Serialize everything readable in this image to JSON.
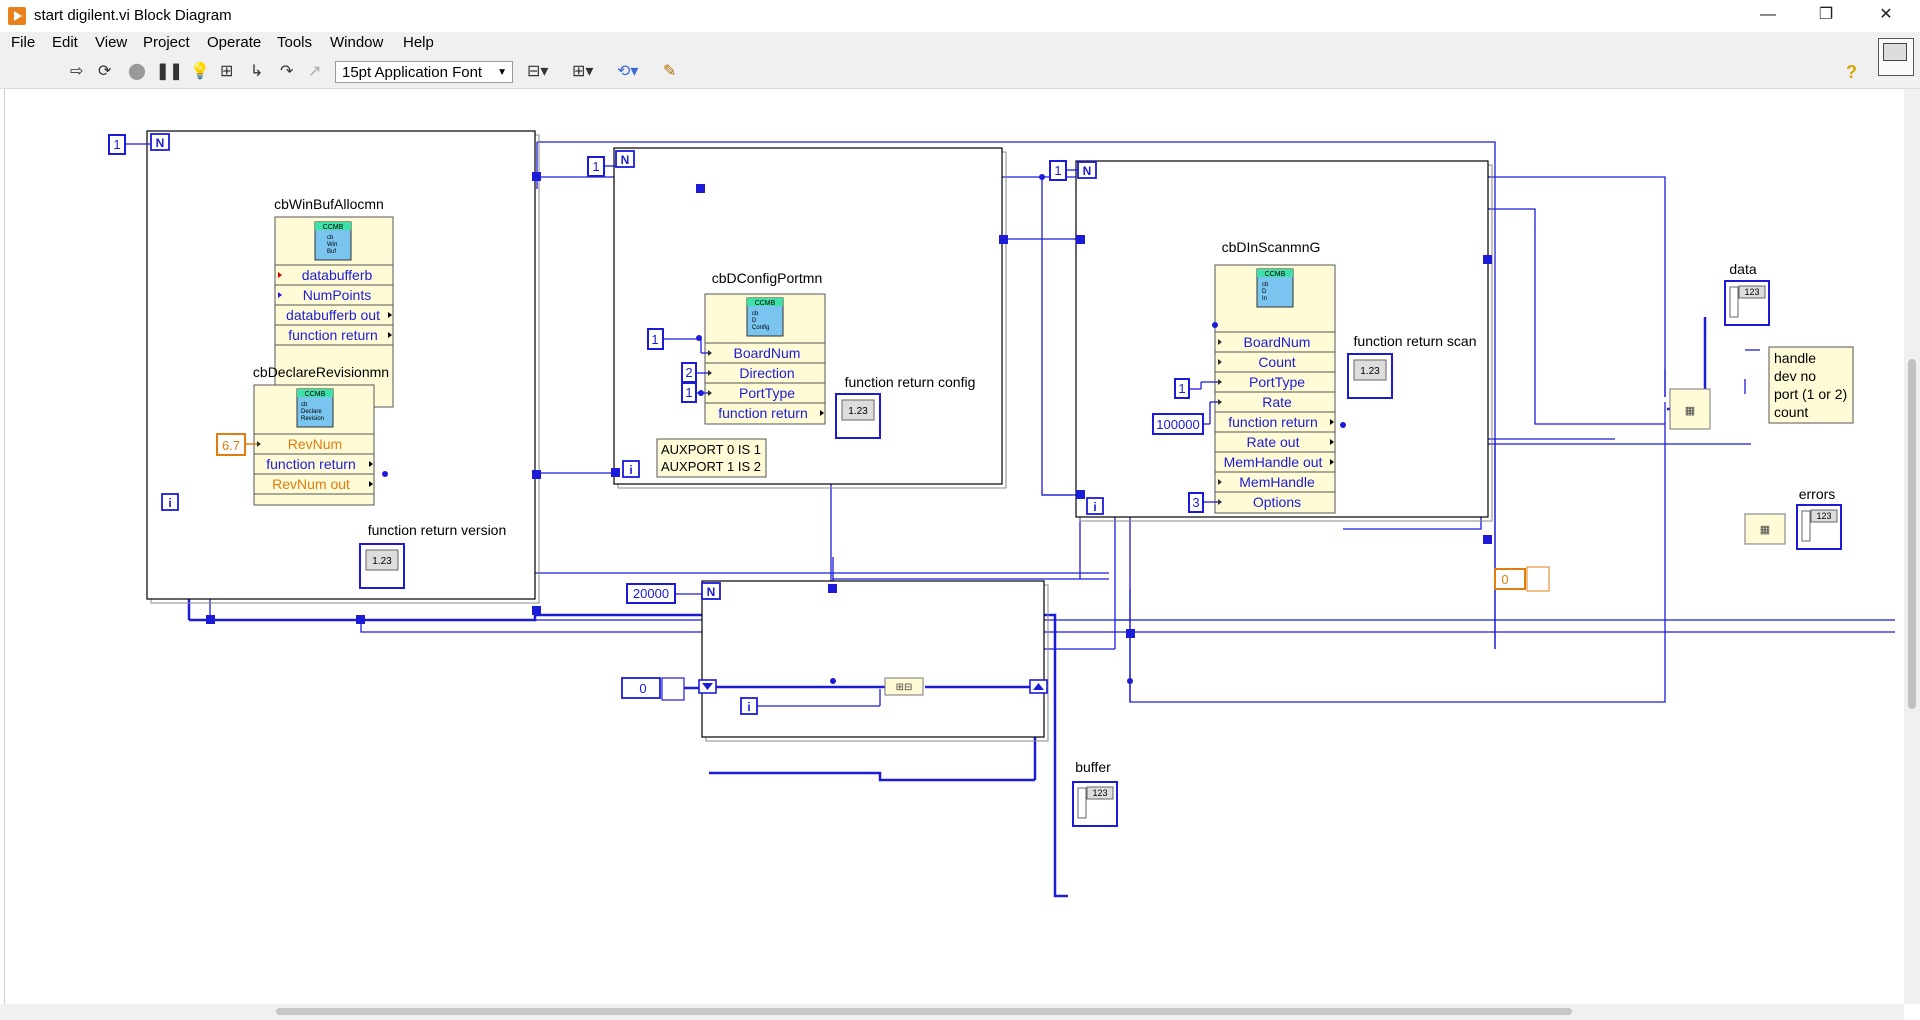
{
  "window": {
    "title": "start digilent.vi Block Diagram",
    "minimize": "—",
    "restore": "❐",
    "close": "✕"
  },
  "menu": [
    "File",
    "Edit",
    "View",
    "Project",
    "Operate",
    "Tools",
    "Window",
    "Help"
  ],
  "toolbar": {
    "font": "15pt Application Font",
    "help": "?"
  },
  "diagram": {
    "loops": [
      {
        "count": "1",
        "n": "N",
        "i": "i"
      },
      {
        "count": "1",
        "n": "N",
        "i": "i"
      },
      {
        "count": "1",
        "n": "N",
        "i": "i"
      },
      {
        "count": "20000",
        "n": "N",
        "i": "i"
      }
    ],
    "subvis": [
      {
        "title": "cbWinBufAllocmn",
        "icon": [
          "CCMB",
          "cb",
          "Win",
          "Buf"
        ],
        "terminals": [
          "databufferb",
          "NumPoints",
          "databufferb out",
          "function return"
        ]
      },
      {
        "title": "cbDeclareRevisionmn",
        "icon": [
          "CCMB",
          "cb",
          "Declare",
          "Revision"
        ],
        "terminals": [
          "RevNum",
          "function return",
          "RevNum out"
        ]
      },
      {
        "title": "cbDConfigPortmn",
        "icon": [
          "CCMB",
          "cb",
          "D",
          "Config"
        ],
        "terminals": [
          "BoardNum",
          "Direction",
          "PortType",
          "function return"
        ]
      },
      {
        "title": "cbDInScanmnG",
        "icon": [
          "CCMB",
          "cb",
          "D",
          "In"
        ],
        "terminals": [
          "BoardNum",
          "Count",
          "PortType",
          "Rate",
          "function return",
          "Rate out",
          "MemHandle out",
          "MemHandle",
          "Options"
        ]
      }
    ],
    "constants": {
      "rev": "6.7",
      "board_cfg": "1",
      "direction": "2",
      "porttype_cfg": "1",
      "porttype_scan": "1",
      "rate": "100000",
      "options": "3",
      "init": "0",
      "errors_init": "0"
    },
    "indicators": {
      "version": "function return version",
      "config": "function return config",
      "scan": "function return scan",
      "data": "data",
      "errors": "errors",
      "buffer": "buffer",
      "num": "1.23",
      "array": "123"
    },
    "comments": {
      "aux": [
        "AUXPORT 0 IS 1",
        "AUXPORT 1 IS 2"
      ],
      "cluster": [
        "handle",
        "dev no",
        "port (1 or 2)",
        "count"
      ]
    }
  },
  "colors": {
    "wire": "#1c1cd8",
    "loop_border": "#000000",
    "subvi_bg": "#fffbd6",
    "orange_text": "#e07c10",
    "comment_bg": "#fffbd6"
  }
}
